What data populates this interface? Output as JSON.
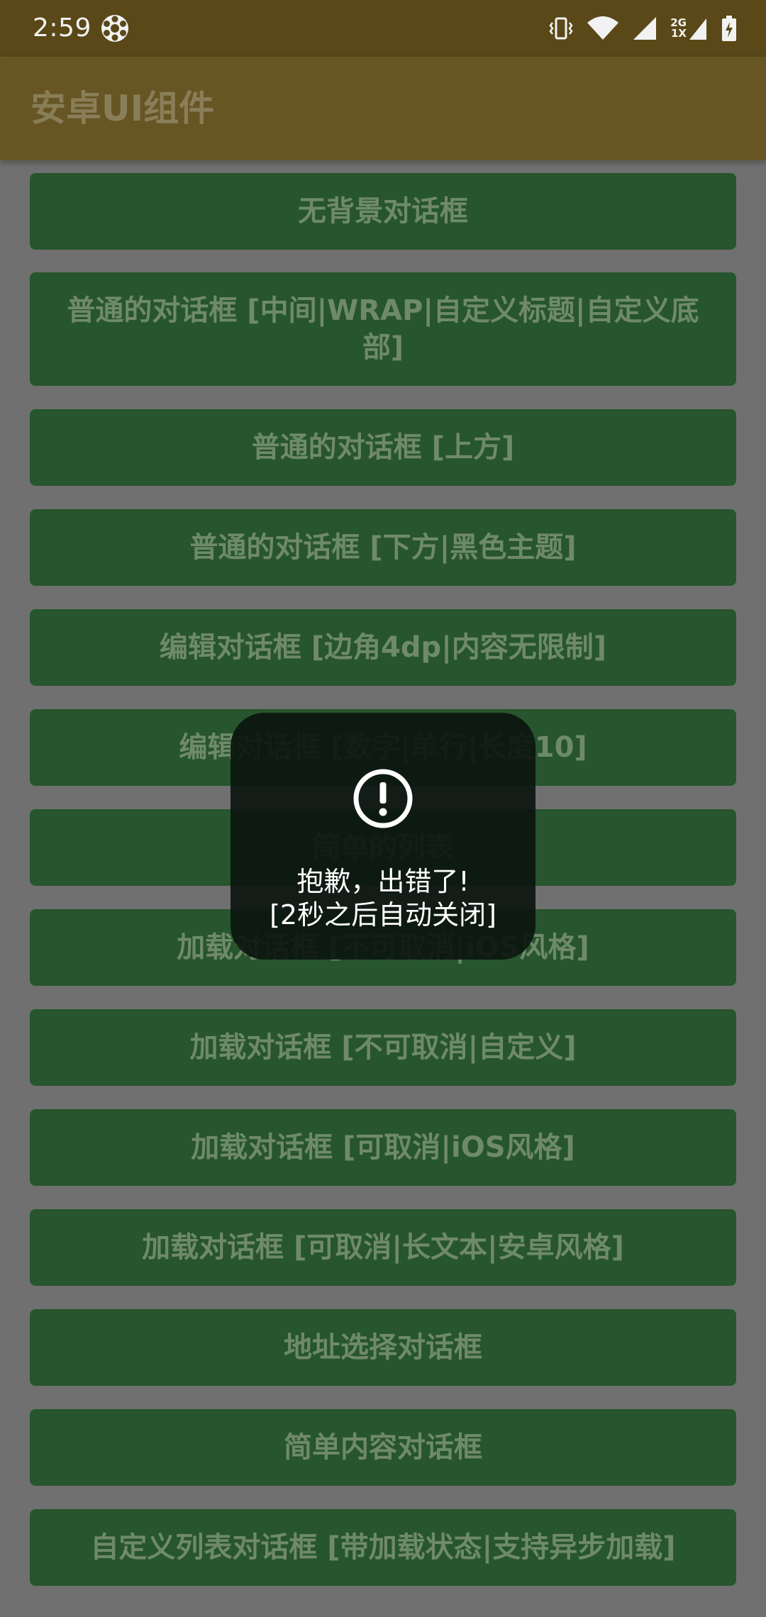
{
  "status_bar": {
    "time": "2:59",
    "network_label_top": "2G",
    "network_label_bottom": "1X"
  },
  "app_bar": {
    "title": "安卓UI组件"
  },
  "buttons": [
    "无背景对话框",
    "普通的对话框 [中间|WRAP|自定义标题|自定义底部]",
    "普通的对话框 [上方]",
    "普通的对话框 [下方|黑色主题]",
    "编辑对话框 [边角4dp|内容无限制]",
    "编辑对话框 [数字|单行|长度10]",
    "简单的列表",
    "加载对话框 [不可取消|iOS风格]",
    "加载对话框 [不可取消|自定义]",
    "加载对话框 [可取消|iOS风格]",
    "加载对话框 [可取消|长文本|安卓风格]",
    "地址选择对话框",
    "简单内容对话框",
    "自定义列表对话框 [带加载状态|支持异步加载]"
  ],
  "toast": {
    "icon": "exclamation-circle-icon",
    "line1": "抱歉，出错了!",
    "line2": "[2秒之后自动关闭]"
  },
  "colors": {
    "status_bar": "#5a4818",
    "app_bar": "#675624",
    "button_bg": "#27552d",
    "button_text": "#6f8a69",
    "page_bg": "#707070",
    "toast_bg": "#0c1610"
  }
}
